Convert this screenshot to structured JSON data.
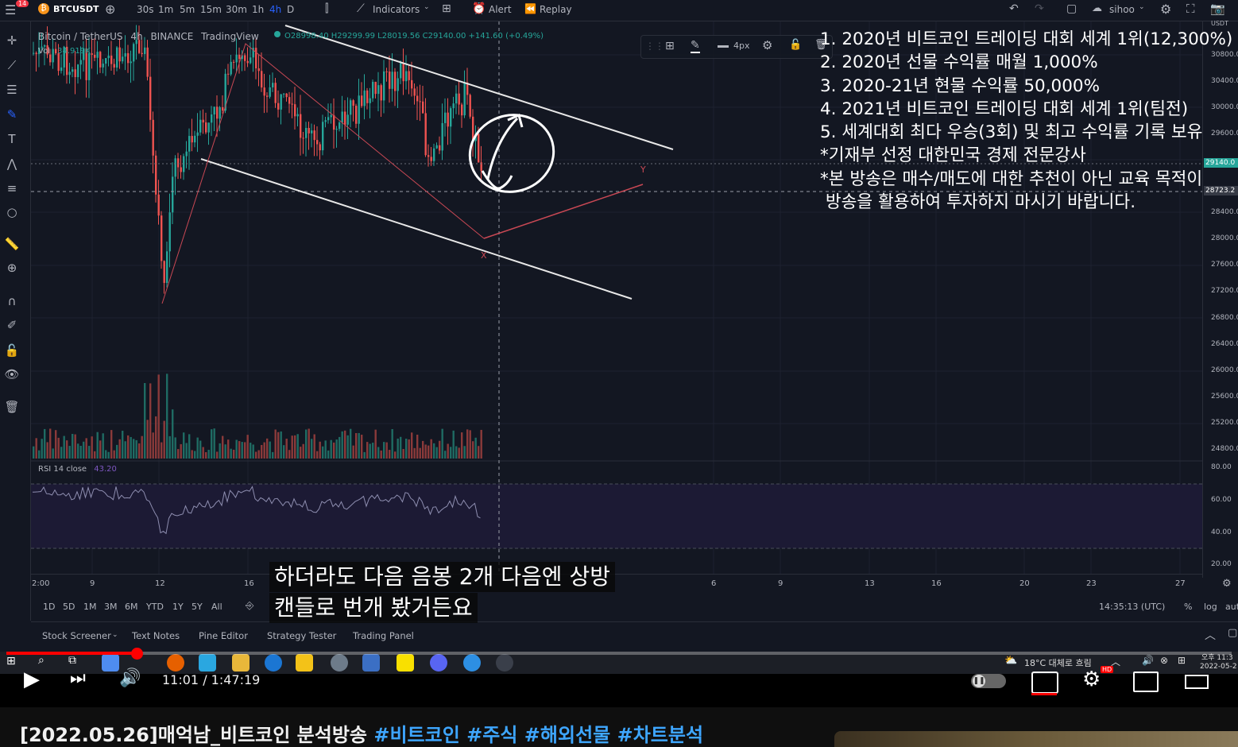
{
  "topbar": {
    "badge": "14",
    "symbol": "BTCUSDT",
    "intervals": [
      "30s",
      "1m",
      "5m",
      "15m",
      "30m",
      "1h",
      "4h",
      "D"
    ],
    "active_interval": "4h",
    "indicators_label": "Indicators",
    "alert_label": "Alert",
    "replay_label": "Replay",
    "user": "sihoo"
  },
  "legend": {
    "pair": "Bitcoin / TetherUS",
    "interval": "4h",
    "exchange": "BINANCE",
    "source": "TradingView",
    "ohlc": "O28998.40  H29299.99  L28019.56  C29140.00  +141.60 (+0.49%)",
    "vol_label": "Vol",
    "vol_value": "34.919K",
    "rsi_label": "RSI 14 close",
    "rsi_value": "43.20"
  },
  "drawing_toolbar": {
    "width_label": "4px"
  },
  "price_axis": {
    "labels": [
      "30800.0",
      "30400.0",
      "30000.0",
      "29600.0",
      "29140.0",
      "28723.2",
      "28400.0",
      "28000.0",
      "27600.0",
      "27200.0",
      "26800.0",
      "26400.0",
      "26000.0",
      "25600.0",
      "25200.0",
      "24800.0"
    ],
    "rsi_labels": [
      "80.00",
      "60.00",
      "40.00",
      "20.00"
    ],
    "current_price": "29140.0",
    "current_tag": "28723.2"
  },
  "time_axis": {
    "labels": [
      "2:00",
      "9",
      "12",
      "16",
      "6",
      "9",
      "13",
      "16",
      "20",
      "23",
      "27"
    ],
    "clock": "14:35:13 (UTC)",
    "percent": "%",
    "log": "log",
    "auto": "aut"
  },
  "range_buttons": [
    "1D",
    "5D",
    "1M",
    "3M",
    "6M",
    "YTD",
    "1Y",
    "5Y",
    "All"
  ],
  "bottom_tabs": [
    "Stock Screener",
    "Text Notes",
    "Pine Editor",
    "Strategy Tester",
    "Trading Panel"
  ],
  "overlay_lines": [
    "1. 2020년 비트코인 트레이딩 대회 세계 1위(12,300%)",
    "2. 2020년 선물 수익률 매월 1,000%",
    "3. 2020-21년 현물 수익률 50,000%",
    "4. 2021년 비트코인 트레이딩 대회 세계 1위(팀전)",
    "5. 세계대회 최다 우승(3회) 및 최고 수익률 기록 보유",
    "*기재부 선정 대한민국 경제 전문강사",
    "*본 방송은 매수/매도에 대한 추천이 아닌 교육 목적이",
    " 방송을 활용하여 투자하지 마시기 바랍니다."
  ],
  "chart_marks": {
    "x_label": "X",
    "y_label": "Y"
  },
  "subtitles": [
    "하더라도 다음 음봉 2개 다음엔 상방",
    "캔들로 번개 봤거든요"
  ],
  "taskbar": {
    "weather": "18°C  대체로 흐림",
    "time": "오후 11:3",
    "date": "2022-05-2"
  },
  "player": {
    "timecode": "11:01 / 1:47:19",
    "progress": 0.1023
  },
  "video_title": {
    "main": "[2022.05.26]매억남_비트코인 분석방송 ",
    "tags": [
      "#비트코인",
      "#주식",
      "#해외선물",
      "#차트분석"
    ]
  },
  "colors": {
    "bg": "#131722",
    "up": "#26a69a",
    "down": "#ef5350",
    "youtube_red": "#ff0000"
  }
}
